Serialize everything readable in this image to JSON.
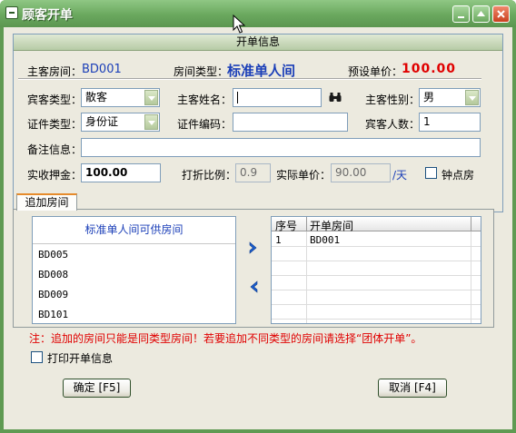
{
  "window": {
    "title": "顾客开单"
  },
  "panel": {
    "header": "开单信息"
  },
  "info": {
    "room_label": "主客房间：",
    "room_value": "BD001",
    "type_label": "房间类型：",
    "type_value": "标准单人间",
    "price_label": "预设单价：",
    "price_value": "100.00"
  },
  "form": {
    "guest_type_label": "宾客类型：",
    "guest_type_value": "散客",
    "guest_name_label": "主客姓名：",
    "guest_name_value": "",
    "gender_label": "主客性别：",
    "gender_value": "男",
    "id_type_label": "证件类型：",
    "id_type_value": "身份证",
    "id_no_label": "证件编码：",
    "id_no_value": "",
    "guest_count_label": "宾客人数：",
    "guest_count_value": "1",
    "remark_label": "备注信息：",
    "remark_value": "",
    "deposit_label": "实收押金：",
    "deposit_value": "100.00",
    "discount_label": "打折比例：",
    "discount_value": "0.9",
    "actual_price_label": "实际单价：",
    "actual_price_value": "90.00",
    "per_day": "/天",
    "hourly_label": "钟点房"
  },
  "tab": {
    "label": "追加房间"
  },
  "available": {
    "header": "标准单人间可供房间",
    "items": [
      "BD005",
      "BD008",
      "BD009",
      "BD101"
    ]
  },
  "open_rooms": {
    "col_no": "序号",
    "col_room": "开单房间",
    "rows": [
      {
        "no": "1",
        "room": "BD001"
      }
    ]
  },
  "note": "注：追加的房间只能是同类型房间！若要追加不同类型的房间请选择“团体开单”。",
  "print_label": "打印开单信息",
  "buttons": {
    "ok": "确定 [F5]",
    "cancel": "取消 [F4]"
  },
  "colors": {
    "titlebar": "#6aa85e",
    "value_blue": "#1b3fb8",
    "price_red": "#e00000",
    "tab_accent": "#e68b2c"
  },
  "icons": {
    "find": "binoculars-icon",
    "add": "chevron-right-icon",
    "remove": "chevron-left-icon"
  }
}
